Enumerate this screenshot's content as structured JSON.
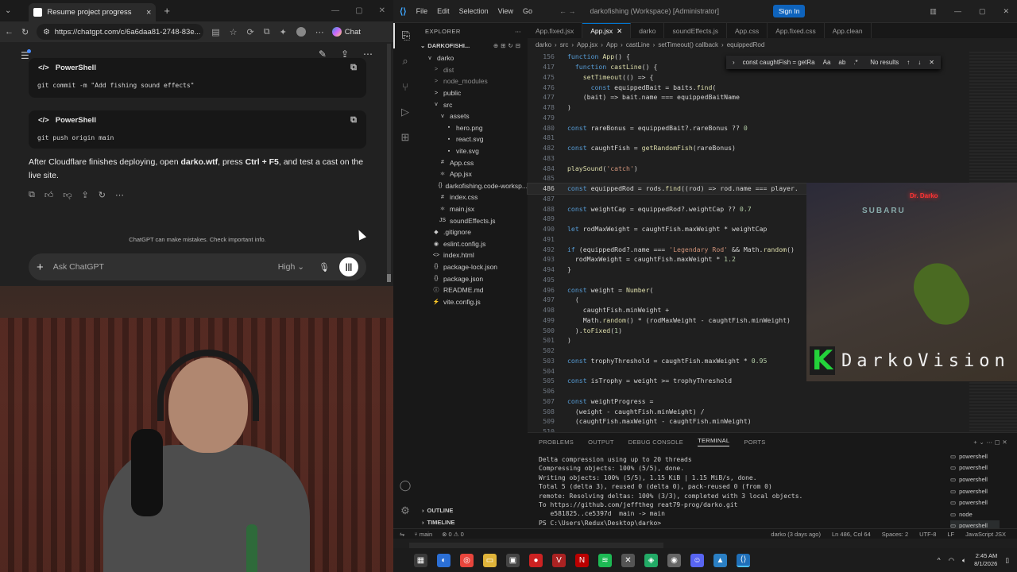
{
  "browser": {
    "tab_title": "Resume project progress",
    "url": "https://chatgpt.com/c/6a6daa81-2748-83e...",
    "copilot_label": "Chat",
    "code_blocks": [
      {
        "lang": "PowerShell",
        "code": "git commit -m \"Add fishing sound effects\""
      },
      {
        "lang": "PowerShell",
        "code": "git push origin main"
      }
    ],
    "message_parts": [
      "After Cloudflare finishes deploying, open ",
      "darko.wtf",
      ", press ",
      "Ctrl + F5",
      ", and test a cast on the live site."
    ],
    "disclaimer": "ChatGPT can make mistakes. Check important info.",
    "composer_placeholder": "Ask ChatGPT",
    "model": "High"
  },
  "vscode": {
    "workspace_title": "darkofishing (Workspace) [Administrator]",
    "menu": [
      "File",
      "Edit",
      "Selection",
      "View",
      "Go"
    ],
    "sign_in": "Sign In",
    "explorer_title": "EXPLORER",
    "workspace_root": "DARKOFISHI...",
    "tree": [
      {
        "label": "darko",
        "icon": "v",
        "indent": 0,
        "color": "#ccc"
      },
      {
        "label": "dist",
        "icon": ">",
        "indent": 1,
        "color": "#8b8b8b"
      },
      {
        "label": "node_modules",
        "icon": ">",
        "indent": 1,
        "color": "#8b8b8b"
      },
      {
        "label": "public",
        "icon": ">",
        "indent": 1,
        "color": "#ccc"
      },
      {
        "label": "src",
        "icon": "v",
        "indent": 1,
        "color": "#ccc"
      },
      {
        "label": "assets",
        "icon": "v",
        "indent": 2,
        "color": "#ccc"
      },
      {
        "label": "hero.png",
        "icon": "▪",
        "indent": 3,
        "color": "#ccc"
      },
      {
        "label": "react.svg",
        "icon": "▪",
        "indent": 3,
        "color": "#ccc"
      },
      {
        "label": "vite.svg",
        "icon": "▪",
        "indent": 3,
        "color": "#ccc"
      },
      {
        "label": "App.css",
        "icon": "#",
        "indent": 2,
        "color": "#ccc"
      },
      {
        "label": "App.jsx",
        "icon": "⚛",
        "indent": 2,
        "color": "#ccc"
      },
      {
        "label": "darkofishing.code-worksp...",
        "icon": "{}",
        "indent": 2,
        "color": "#ccc"
      },
      {
        "label": "index.css",
        "icon": "#",
        "indent": 2,
        "color": "#ccc"
      },
      {
        "label": "main.jsx",
        "icon": "⚛",
        "indent": 2,
        "color": "#ccc"
      },
      {
        "label": "soundEffects.js",
        "icon": "JS",
        "indent": 2,
        "color": "#ccc"
      },
      {
        "label": ".gitignore",
        "icon": "◆",
        "indent": 1,
        "color": "#ccc"
      },
      {
        "label": "eslint.config.js",
        "icon": "◉",
        "indent": 1,
        "color": "#ccc"
      },
      {
        "label": "index.html",
        "icon": "<>",
        "indent": 1,
        "color": "#ccc"
      },
      {
        "label": "package-lock.json",
        "icon": "{}",
        "indent": 1,
        "color": "#ccc"
      },
      {
        "label": "package.json",
        "icon": "{}",
        "indent": 1,
        "color": "#ccc"
      },
      {
        "label": "README.md",
        "icon": "ⓘ",
        "indent": 1,
        "color": "#ccc"
      },
      {
        "label": "vite.config.js",
        "icon": "⚡",
        "indent": 1,
        "color": "#ccc"
      }
    ],
    "outline": "OUTLINE",
    "timeline": "TIMELINE",
    "tabs": [
      "App.fixed.jsx",
      "App.jsx",
      "darko",
      "soundEffects.js",
      "App.css",
      "App.fixed.css",
      "App.clean"
    ],
    "active_tab": 1,
    "breadcrumb": [
      "darko",
      "src",
      "App.jsx",
      "App",
      "castLine",
      "setTimeout() callback",
      "equippedRod"
    ],
    "find_text": "const caughtFish = getRa",
    "find_result": "No results",
    "code": [
      {
        "n": "156",
        "t": "function App() {"
      },
      {
        "n": "417",
        "t": "  function castLine() {"
      },
      {
        "n": "475",
        "t": "    setTimeout(() => {"
      },
      {
        "n": "476",
        "t": "      const equippedBait = baits.find("
      },
      {
        "n": "477",
        "t": "    (bait) => bait.name === equippedBaitName"
      },
      {
        "n": "478",
        "t": ")"
      },
      {
        "n": "479",
        "t": ""
      },
      {
        "n": "480",
        "t": "const rareBonus = equippedBait?.rareBonus ?? 0"
      },
      {
        "n": "481",
        "t": ""
      },
      {
        "n": "482",
        "t": "const caughtFish = getRandomFish(rareBonus)"
      },
      {
        "n": "483",
        "t": ""
      },
      {
        "n": "484",
        "t": "playSound('catch')"
      },
      {
        "n": "485",
        "t": ""
      },
      {
        "n": "486",
        "t": "const equippedRod = rods.find((rod) => rod.name === player."
      },
      {
        "n": "487",
        "t": ""
      },
      {
        "n": "488",
        "t": "const weightCap = equippedRod?.weightCap ?? 0.7"
      },
      {
        "n": "489",
        "t": ""
      },
      {
        "n": "490",
        "t": "let rodMaxWeight = caughtFish.maxWeight * weightCap"
      },
      {
        "n": "491",
        "t": ""
      },
      {
        "n": "492",
        "t": "if (equippedRod?.name === 'Legendary Rod' && Math.random()"
      },
      {
        "n": "493",
        "t": "  rodMaxWeight = caughtFish.maxWeight * 1.2"
      },
      {
        "n": "494",
        "t": "}"
      },
      {
        "n": "495",
        "t": ""
      },
      {
        "n": "496",
        "t": "const weight = Number("
      },
      {
        "n": "497",
        "t": "  ("
      },
      {
        "n": "498",
        "t": "    caughtFish.minWeight +"
      },
      {
        "n": "499",
        "t": "    Math.random() * (rodMaxWeight - caughtFish.minWeight)"
      },
      {
        "n": "500",
        "t": "  ).toFixed(1)"
      },
      {
        "n": "501",
        "t": ")"
      },
      {
        "n": "502",
        "t": ""
      },
      {
        "n": "503",
        "t": "const trophyThreshold = caughtFish.maxWeight * 0.95"
      },
      {
        "n": "504",
        "t": ""
      },
      {
        "n": "505",
        "t": "const isTrophy = weight >= trophyThreshold"
      },
      {
        "n": "506",
        "t": ""
      },
      {
        "n": "507",
        "t": "const weightProgress ="
      },
      {
        "n": "508",
        "t": "  (weight - caughtFish.minWeight) /"
      },
      {
        "n": "509",
        "t": "  (caughtFish.maxWeight - caughtFish.minWeight)"
      },
      {
        "n": "510",
        "t": ""
      }
    ],
    "current_line": "486",
    "panel_tabs": [
      "PROBLEMS",
      "OUTPUT",
      "DEBUG CONSOLE",
      "TERMINAL",
      "PORTS"
    ],
    "active_panel_tab": 3,
    "terminal_lines": [
      "Delta compression using up to 20 threads",
      "Compressing objects: 100% (5/5), done.",
      "Writing objects: 100% (5/5), 1.15 KiB | 1.15 MiB/s, done.",
      "Total 5 (delta 3), reused 0 (delta 0), pack-reused 0 (from 0)",
      "remote: Resolving deltas: 100% (3/3), completed with 3 local objects.",
      "To https://github.com/jefftheg reat79-prog/darko.git",
      "   e581825..ce5397d  main -> main",
      "PS C:\\Users\\Redux\\Desktop\\darko> "
    ],
    "shells": [
      "powershell",
      "powershell",
      "powershell",
      "powershell",
      "powershell",
      "node",
      "powershell"
    ],
    "status": {
      "branch": "main",
      "errors": "0",
      "warnings": "0",
      "blame": "darko (3 days ago)",
      "position": "Ln 486, Col 64",
      "spaces": "Spaces: 2",
      "encoding": "UTF-8",
      "eol": "LF",
      "language": "JavaScript JSX"
    }
  },
  "stream": {
    "brand_letter": "K",
    "brand_name": "DarkoVision",
    "sign_text": "Dr. Darko",
    "car_text": "SUBARU"
  },
  "taskbar": {
    "time": "2:45 AM",
    "date": "8/1/2026"
  }
}
